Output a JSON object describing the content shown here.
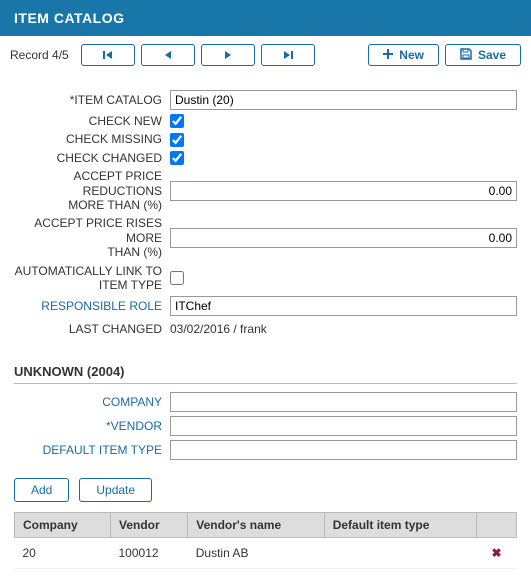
{
  "header": {
    "title": "ITEM CATALOG"
  },
  "toolbar": {
    "record_label": "Record 4/5",
    "new_label": "New",
    "save_label": "Save"
  },
  "form": {
    "item_catalog": {
      "label": "*ITEM CATALOG",
      "value": "Dustin (20)"
    },
    "check_new": {
      "label": "CHECK NEW",
      "checked": true
    },
    "check_missing": {
      "label": "CHECK MISSING",
      "checked": true
    },
    "check_changed": {
      "label": "CHECK CHANGED",
      "checked": true
    },
    "accept_price_reductions": {
      "label_l1": "ACCEPT PRICE REDUCTIONS",
      "label_l2": "MORE THAN (%)",
      "value": "0.00"
    },
    "accept_price_rises": {
      "label_l1": "ACCEPT PRICE RISES MORE",
      "label_l2": "THAN (%)",
      "value": "0.00"
    },
    "auto_link": {
      "label_l1": "AUTOMATICALLY LINK TO",
      "label_l2": "ITEM TYPE",
      "checked": false
    },
    "responsible_role": {
      "label": "RESPONSIBLE ROLE",
      "value": "ITChef"
    },
    "last_changed": {
      "label": "LAST CHANGED",
      "value": "03/02/2016 / frank"
    }
  },
  "section": {
    "title": "UNKNOWN (2004)",
    "company": {
      "label": "COMPANY",
      "value": ""
    },
    "vendor": {
      "label": "*VENDOR",
      "value": ""
    },
    "default_item_type": {
      "label": "DEFAULT ITEM TYPE",
      "value": ""
    },
    "add_label": "Add",
    "update_label": "Update"
  },
  "grid": {
    "headers": [
      "Company",
      "Vendor",
      "Vendor's name",
      "Default item type"
    ],
    "rows": [
      {
        "company": "20",
        "vendor": "100012",
        "vendor_name": "Dustin AB",
        "default_item_type": ""
      }
    ]
  }
}
